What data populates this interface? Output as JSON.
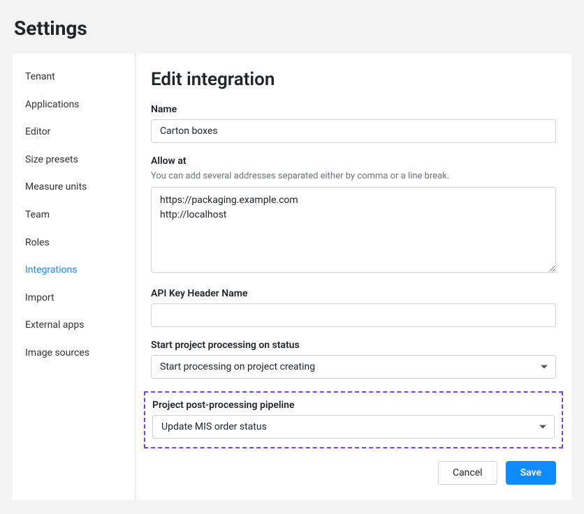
{
  "page_title": "Settings",
  "sidebar": {
    "items": [
      {
        "label": "Tenant",
        "active": false
      },
      {
        "label": "Applications",
        "active": false
      },
      {
        "label": "Editor",
        "active": false
      },
      {
        "label": "Size presets",
        "active": false
      },
      {
        "label": "Measure units",
        "active": false
      },
      {
        "label": "Team",
        "active": false
      },
      {
        "label": "Roles",
        "active": false
      },
      {
        "label": "Integrations",
        "active": true
      },
      {
        "label": "Import",
        "active": false
      },
      {
        "label": "External apps",
        "active": false
      },
      {
        "label": "Image sources",
        "active": false
      }
    ]
  },
  "main": {
    "title": "Edit integration",
    "name": {
      "label": "Name",
      "value": "Carton boxes"
    },
    "allow_at": {
      "label": "Allow at",
      "help": "You can add several addresses separated either by comma or a line break.",
      "value": "https://packaging.example.com\nhttp://localhost"
    },
    "api_key_header": {
      "label": "API Key Header Name",
      "value": ""
    },
    "start_processing": {
      "label": "Start project processing on status",
      "value": "Start processing on project creating"
    },
    "post_pipeline": {
      "label": "Project post-processing pipeline",
      "value": "Update MIS order status"
    },
    "buttons": {
      "cancel": "Cancel",
      "save": "Save"
    }
  }
}
